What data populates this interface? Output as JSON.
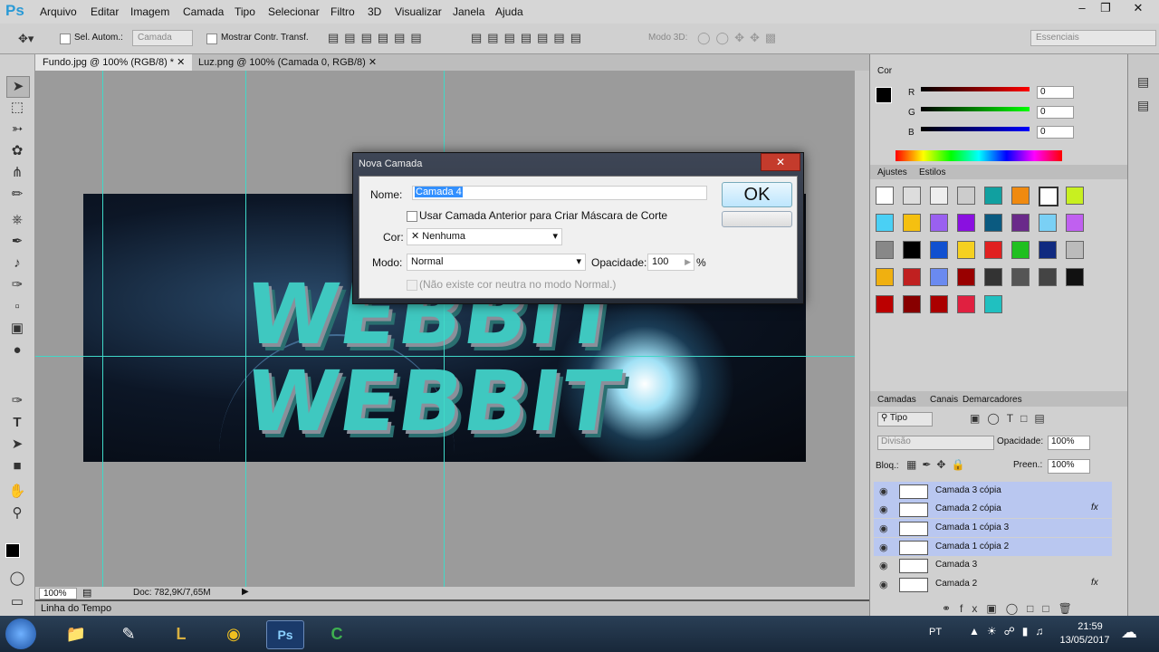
{
  "app": {
    "logo": "Ps"
  },
  "menu": [
    "Arquivo",
    "Editar",
    "Imagem",
    "Camada",
    "Tipo",
    "Selecionar",
    "Filtro",
    "3D",
    "Visualizar",
    "Janela",
    "Ajuda"
  ],
  "options": {
    "auto_select_label": "Sel. Autom.:",
    "auto_select_value": "Camada",
    "show_transform_label": "Mostrar Contr. Transf.",
    "mode3d_label": "Modo 3D:",
    "workspace": "Essenciais"
  },
  "tabs": [
    "Fundo.jpg @ 100% (RGB/8) *",
    "Luz.png @ 100% (Camada 0, RGB/8)"
  ],
  "status": {
    "zoom": "100%",
    "doc": "Doc: 782,9K/7,65M"
  },
  "timeline": {
    "label": "Linha do Tempo"
  },
  "color_panel": {
    "title": "Cor",
    "r_label": "R",
    "g_label": "G",
    "b_label": "B",
    "r": "0",
    "g": "0",
    "b": "0"
  },
  "styles_panel": {
    "tab_adjust": "Ajustes",
    "tab_styles": "Estilos"
  },
  "layers_panel": {
    "tabs": [
      "Camadas",
      "Canais",
      "Demarcadores"
    ],
    "filter": "Tipo",
    "blend": "Divisão",
    "opacity_label": "Opacidade:",
    "opacity": "100%",
    "lock_label": "Bloq.:",
    "fill_label": "Preen.:",
    "fill": "100%",
    "layers": [
      {
        "name": "Camada 3 cópia",
        "fx": ""
      },
      {
        "name": "Camada 2 cópia",
        "fx": "fx"
      },
      {
        "name": "Camada 1 cópia 3",
        "fx": ""
      },
      {
        "name": "Camada 1 cópia 2",
        "fx": ""
      },
      {
        "name": "Camada 3",
        "fx": ""
      },
      {
        "name": "Camada 2",
        "fx": "fx"
      }
    ]
  },
  "dialog": {
    "title": "Nova Camada",
    "name_label": "Nome:",
    "name_value": "Camada 4",
    "clip_label": "Usar Camada Anterior para Criar Máscara de Corte",
    "color_label": "Cor:",
    "color_value": "Nenhuma",
    "mode_label": "Modo:",
    "mode_value": "Normal",
    "opacity_label": "Opacidade:",
    "opacity_value": "100",
    "percent": "%",
    "neutral_label": "(Não existe cor neutra no modo Normal.)",
    "ok": "OK"
  },
  "artwork": {
    "line1": "WEBBIT",
    "line2": "WEBBIT"
  },
  "taskbar": {
    "lang": "PT",
    "time": "21:59",
    "date": "13/05/2017"
  },
  "colors": {
    "accent": "#2a9ad6",
    "guide": "#40d8c8",
    "selected_layer": "#b9c7f0"
  }
}
